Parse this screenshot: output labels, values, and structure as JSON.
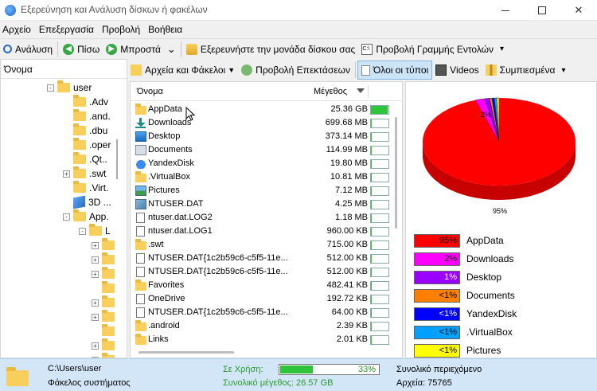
{
  "window": {
    "title": "Εξερεύνηση και Ανάλυση δίσκων ή φακέλων"
  },
  "menu": [
    "Αρχείο",
    "Επεξεργασία",
    "Προβολή",
    "Βοήθεια"
  ],
  "toolbar": {
    "analyze": "Ανάλυση",
    "back": "Πίσω",
    "forward": "Μπροστά",
    "explore_drive": "Εξερευνήστε την μονάδα δίσκου σας",
    "cmdline": "Προβολή Γραμμής Εντολών"
  },
  "subbar": {
    "files_folders": "Αρχεία και Φάκελοι",
    "extensions": "Προβολή Επεκτάσεων",
    "all_types": "Όλοι οι τύποι",
    "videos": "Videos",
    "compressed": "Συμπιεσμένα"
  },
  "tree": {
    "header": "Όνομα",
    "items": [
      {
        "label": "user",
        "level": 0,
        "icon": "folder",
        "expander": "-"
      },
      {
        "label": ".Adv",
        "level": 1,
        "icon": "folder",
        "expander": ""
      },
      {
        "label": ".and.",
        "level": 1,
        "icon": "folder",
        "expander": ""
      },
      {
        "label": ".dbu",
        "level": 1,
        "icon": "folder",
        "expander": ""
      },
      {
        "label": ".oper",
        "level": 1,
        "icon": "folder",
        "expander": ""
      },
      {
        "label": ".Qt..",
        "level": 1,
        "icon": "folder",
        "expander": ""
      },
      {
        "label": ".swt",
        "level": 1,
        "icon": "folder",
        "expander": "+"
      },
      {
        "label": ".Virt.",
        "level": 1,
        "icon": "folder",
        "expander": ""
      },
      {
        "label": "3D ...",
        "level": 1,
        "icon": "cube",
        "expander": ""
      },
      {
        "label": "App.",
        "level": 1,
        "icon": "folder",
        "expander": "-"
      },
      {
        "label": "L",
        "level": 2,
        "icon": "folder",
        "expander": "-"
      },
      {
        "label": "",
        "level": 3,
        "icon": "folder",
        "expander": "+"
      },
      {
        "label": "",
        "level": 3,
        "icon": "folder",
        "expander": "+"
      },
      {
        "label": "",
        "level": 3,
        "icon": "folder",
        "expander": "+"
      },
      {
        "label": "",
        "level": 3,
        "icon": "folder",
        "expander": ""
      },
      {
        "label": "",
        "level": 3,
        "icon": "folder",
        "expander": "+"
      },
      {
        "label": "",
        "level": 3,
        "icon": "folder",
        "expander": "+"
      },
      {
        "label": "",
        "level": 3,
        "icon": "folder",
        "expander": ""
      },
      {
        "label": "",
        "level": 3,
        "icon": "folder",
        "expander": "+"
      },
      {
        "label": "",
        "level": 3,
        "icon": "folder",
        "expander": "+"
      }
    ]
  },
  "list": {
    "col_name": "Όνομα",
    "col_size": "Μέγεθος",
    "rows": [
      {
        "name": "AppData",
        "size": "25.36 GB",
        "pct": 95,
        "icon": "folder"
      },
      {
        "name": "Downloads",
        "size": "699.68 MB",
        "pct": 3,
        "icon": "download"
      },
      {
        "name": "Desktop",
        "size": "373.14 MB",
        "pct": 1,
        "icon": "desktop"
      },
      {
        "name": "Documents",
        "size": "114.99 MB",
        "pct": 0,
        "icon": "documents"
      },
      {
        "name": "YandexDisk",
        "size": "19.80 MB",
        "pct": 0,
        "icon": "cloud"
      },
      {
        "name": ".VirtualBox",
        "size": "10.81 MB",
        "pct": 0,
        "icon": "folder"
      },
      {
        "name": "Pictures",
        "size": "7.12 MB",
        "pct": 0,
        "icon": "pictures"
      },
      {
        "name": "NTUSER.DAT",
        "size": "4.25 MB",
        "pct": 0,
        "icon": "ntuser"
      },
      {
        "name": "ntuser.dat.LOG2",
        "size": "1.18 MB",
        "pct": 0,
        "icon": "file"
      },
      {
        "name": "ntuser.dat.LOG1",
        "size": "960.00 KB",
        "pct": 0,
        "icon": "file"
      },
      {
        "name": ".swt",
        "size": "715.00 KB",
        "pct": 0,
        "icon": "folder"
      },
      {
        "name": "NTUSER.DAT{1c2b59c6-c5f5-11e...",
        "size": "512.00 KB",
        "pct": 0,
        "icon": "file"
      },
      {
        "name": "NTUSER.DAT{1c2b59c6-c5f5-11e...",
        "size": "512.00 KB",
        "pct": 0,
        "icon": "file"
      },
      {
        "name": "Favorites",
        "size": "482.41 KB",
        "pct": 0,
        "icon": "folder"
      },
      {
        "name": "OneDrive",
        "size": "192.72 KB",
        "pct": 0,
        "icon": "file"
      },
      {
        "name": "NTUSER.DAT{1c2b59c6-c5f5-11e...",
        "size": "64.00 KB",
        "pct": 0,
        "icon": "file"
      },
      {
        "name": ".android",
        "size": "2.39 KB",
        "pct": 0,
        "icon": "folder"
      },
      {
        "name": "Links",
        "size": "2.01 KB",
        "pct": 0,
        "icon": "folder"
      }
    ]
  },
  "chart_data": {
    "type": "pie",
    "labels": [
      "AppData",
      "Downloads",
      "Desktop",
      "Documents",
      "YandexDisk",
      ".VirtualBox",
      "Pictures"
    ],
    "values": [
      95,
      2,
      1,
      0.5,
      0.5,
      0.5,
      0.5
    ],
    "display": [
      "95%",
      "2%",
      "1%",
      "<1%",
      "<1%",
      "<1%",
      "<1%"
    ],
    "slice_labels": {
      "main": "95%",
      "small": "2%"
    },
    "colors": [
      "#ff0000",
      "#ff00ff",
      "#9900ff",
      "#ff8000",
      "#0000ff",
      "#00a0ff",
      "#ffff00"
    ]
  },
  "status": {
    "path": "C:\\Users\\user",
    "folder_type": "Φάκελος συστήματος",
    "in_use_label": "Σε Χρήση:",
    "in_use_pct": 33,
    "in_use_text": "33%",
    "total_size": "Συνολικό μέγεθος: 26.57 GB",
    "total_content": "Συνολικό περιεχόμενο",
    "files": "Αρχεία: 75765"
  }
}
